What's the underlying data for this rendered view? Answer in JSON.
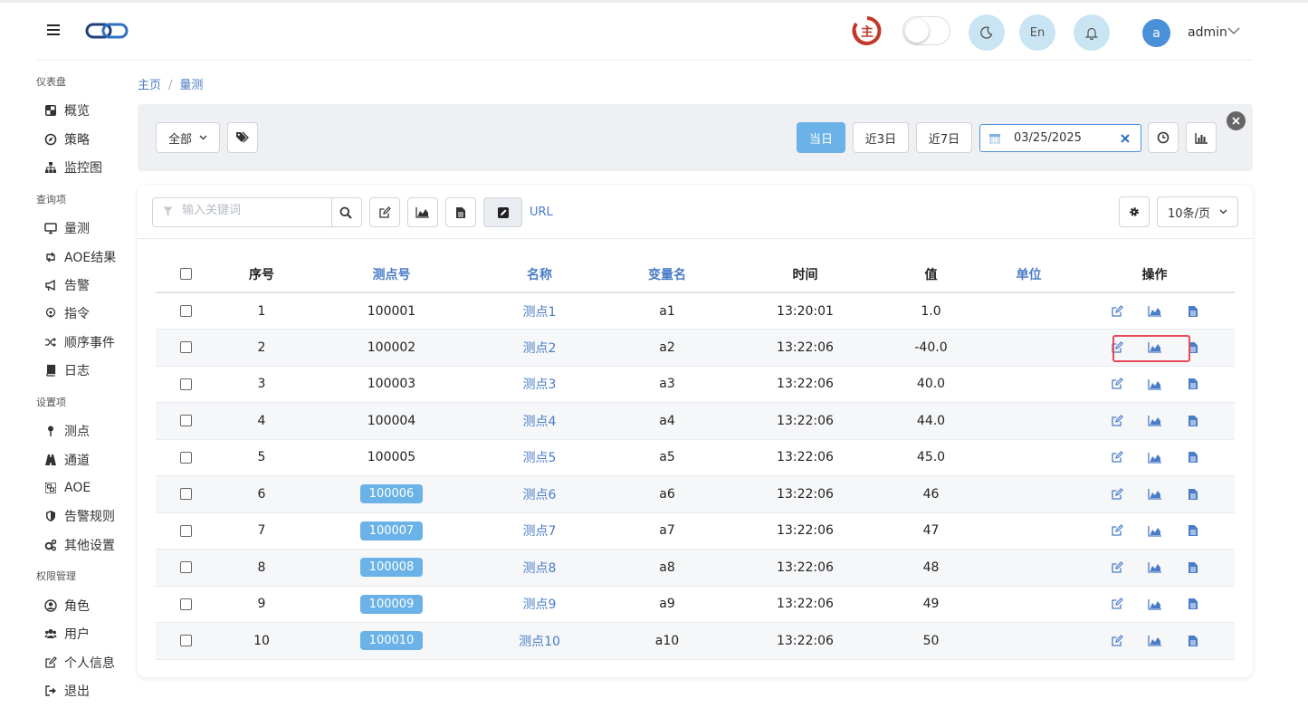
{
  "header": {
    "menu_icon": "hamburger-icon",
    "logo_icon": "chain-link-logo",
    "brand_glyph": "主",
    "theme_icon": "moon-icon",
    "lang_label": "En",
    "bell_icon": "bell-icon",
    "avatar_letter": "a",
    "user_name": "admin"
  },
  "sidebar": {
    "groups": [
      {
        "label": "仪表盘",
        "items": [
          {
            "label": "概览",
            "icon": "dashboard-icon"
          },
          {
            "label": "策略",
            "icon": "compass-icon"
          },
          {
            "label": "监控图",
            "icon": "sitemap-icon"
          }
        ]
      },
      {
        "label": "查询项",
        "items": [
          {
            "label": "量测",
            "icon": "monitor-icon"
          },
          {
            "label": "AOE结果",
            "icon": "retweet-icon"
          },
          {
            "label": "告警",
            "icon": "bullhorn-icon"
          },
          {
            "label": "指令",
            "icon": "podcast-icon"
          },
          {
            "label": "顺序事件",
            "icon": "shuffle-icon"
          },
          {
            "label": "日志",
            "icon": "book-icon"
          }
        ]
      },
      {
        "label": "设置项",
        "items": [
          {
            "label": "测点",
            "icon": "map-pin-icon"
          },
          {
            "label": "通道",
            "icon": "road-icon"
          },
          {
            "label": "AOE",
            "icon": "object-group-icon"
          },
          {
            "label": "告警规则",
            "icon": "shield-icon"
          },
          {
            "label": "其他设置",
            "icon": "gears-icon"
          }
        ]
      },
      {
        "label": "权限管理",
        "items": [
          {
            "label": "角色",
            "icon": "user-circle-icon"
          },
          {
            "label": "用户",
            "icon": "users-icon"
          },
          {
            "label": "个人信息",
            "icon": "edit-icon"
          },
          {
            "label": "退出",
            "icon": "sign-out-icon"
          }
        ]
      }
    ]
  },
  "breadcrumb": {
    "home": "主页",
    "current": "量测"
  },
  "filter": {
    "scope_label": "全部",
    "today_label": "当日",
    "last3_label": "近3日",
    "last7_label": "近7日",
    "date_value": "03/25/2025"
  },
  "toolbar": {
    "search_placeholder": "输入关键词",
    "url_label": "URL",
    "page_size_label": "10条/页"
  },
  "table": {
    "columns": [
      "序号",
      "测点号",
      "名称",
      "变量名",
      "时间",
      "值",
      "单位",
      "操作"
    ],
    "rows": [
      {
        "seq": "1",
        "point": "100001",
        "name": "测点1",
        "var": "a1",
        "time": "13:20:01",
        "value": "1.0",
        "unit": "",
        "pill": false
      },
      {
        "seq": "2",
        "point": "100002",
        "name": "测点2",
        "var": "a2",
        "time": "13:22:06",
        "value": "-40.0",
        "unit": "",
        "pill": false
      },
      {
        "seq": "3",
        "point": "100003",
        "name": "测点3",
        "var": "a3",
        "time": "13:22:06",
        "value": "40.0",
        "unit": "",
        "pill": false
      },
      {
        "seq": "4",
        "point": "100004",
        "name": "测点4",
        "var": "a4",
        "time": "13:22:06",
        "value": "44.0",
        "unit": "",
        "pill": false
      },
      {
        "seq": "5",
        "point": "100005",
        "name": "测点5",
        "var": "a5",
        "time": "13:22:06",
        "value": "45.0",
        "unit": "",
        "pill": false
      },
      {
        "seq": "6",
        "point": "100006",
        "name": "测点6",
        "var": "a6",
        "time": "13:22:06",
        "value": "46",
        "unit": "",
        "pill": true
      },
      {
        "seq": "7",
        "point": "100007",
        "name": "测点7",
        "var": "a7",
        "time": "13:22:06",
        "value": "47",
        "unit": "",
        "pill": true
      },
      {
        "seq": "8",
        "point": "100008",
        "name": "测点8",
        "var": "a8",
        "time": "13:22:06",
        "value": "48",
        "unit": "",
        "pill": true
      },
      {
        "seq": "9",
        "point": "100009",
        "name": "测点9",
        "var": "a9",
        "time": "13:22:06",
        "value": "49",
        "unit": "",
        "pill": true
      },
      {
        "seq": "10",
        "point": "100010",
        "name": "测点10",
        "var": "a10",
        "time": "13:22:06",
        "value": "50",
        "unit": "",
        "pill": true
      }
    ]
  },
  "colors": {
    "accent": "#4a7cc7",
    "primary_button": "#6ab2e7",
    "highlight_box": "#e64a5a"
  }
}
